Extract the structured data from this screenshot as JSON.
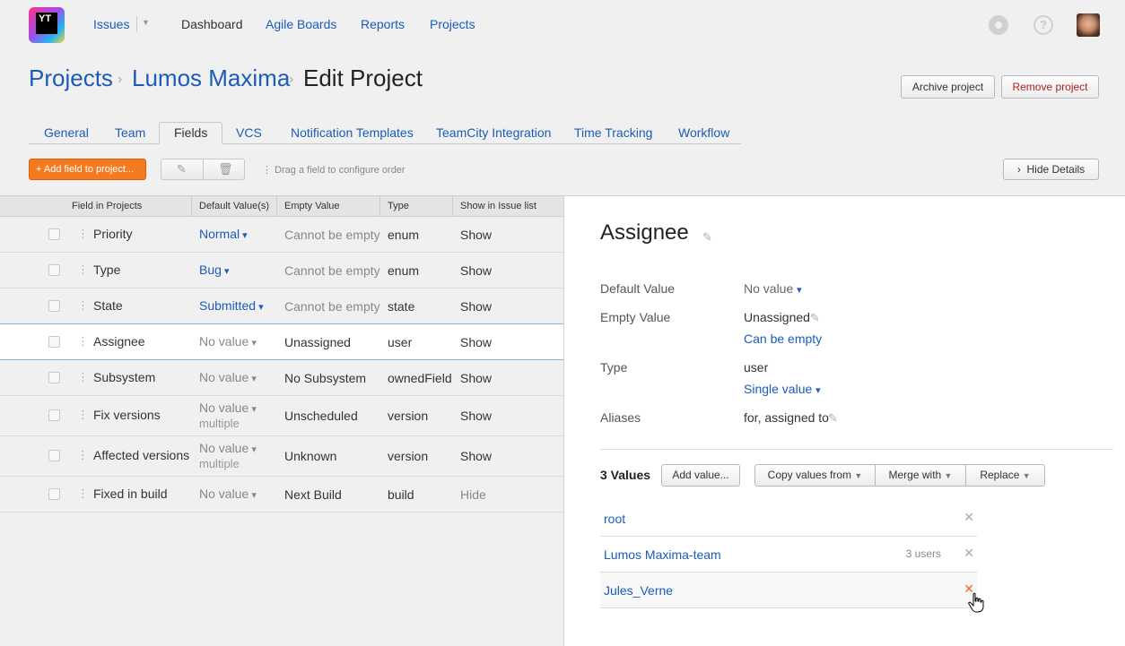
{
  "nav": {
    "logo": "YT",
    "issues": "Issues",
    "dashboard": "Dashboard",
    "agile_boards": "Agile Boards",
    "reports": "Reports",
    "projects": "Projects",
    "help": "?"
  },
  "breadcrumb": {
    "projects": "Projects",
    "project": "Lumos Maxima",
    "current": "Edit Project",
    "separator": "›"
  },
  "header_buttons": {
    "archive": "Archive project",
    "remove": "Remove project"
  },
  "tabs": [
    "General",
    "Team",
    "Fields",
    "VCS",
    "Notification Templates",
    "TeamCity Integration",
    "Time Tracking",
    "Workflow"
  ],
  "toolbar": {
    "add_field": "+ Add field to project...",
    "drag_hint": "Drag a field to configure order",
    "hide_details": "Hide Details"
  },
  "table": {
    "headers": [
      "Field in Projects",
      "Default Value(s)",
      "Empty Value",
      "Type",
      "Show in Issue list"
    ],
    "rows": [
      {
        "name": "Priority",
        "default": "Normal",
        "default_sub": "",
        "empty": "Cannot be empty",
        "type": "enum",
        "show": "Show"
      },
      {
        "name": "Type",
        "default": "Bug",
        "default_sub": "",
        "empty": "Cannot be empty",
        "type": "enum",
        "show": "Show"
      },
      {
        "name": "State",
        "default": "Submitted",
        "default_sub": "",
        "empty": "Cannot be empty",
        "type": "state",
        "show": "Show"
      },
      {
        "name": "Assignee",
        "default": "No value",
        "default_sub": "",
        "empty": "Unassigned",
        "type": "user",
        "show": "Show"
      },
      {
        "name": "Subsystem",
        "default": "No value",
        "default_sub": "",
        "empty": "No Subsystem",
        "type": "ownedField",
        "show": "Show"
      },
      {
        "name": "Fix versions",
        "default": "No value",
        "default_sub": "multiple",
        "empty": "Unscheduled",
        "type": "version",
        "show": "Show"
      },
      {
        "name": "Affected versions",
        "default": "No value",
        "default_sub": "multiple",
        "empty": "Unknown",
        "type": "version",
        "show": "Show"
      },
      {
        "name": "Fixed in build",
        "default": "No value",
        "default_sub": "",
        "empty": "Next Build",
        "type": "build",
        "show": "Hide"
      }
    ]
  },
  "details": {
    "title": "Assignee",
    "default_label": "Default Value",
    "default_value": "No value",
    "empty_label": "Empty Value",
    "empty_value": "Unassigned",
    "empty_link": "Can be empty",
    "type_label": "Type",
    "type_value": "user",
    "type_mode": "Single value",
    "aliases_label": "Aliases",
    "aliases_value": "for, assigned to",
    "values_count": "3 Values",
    "add_value": "Add value...",
    "copy_values": "Copy values from",
    "merge_with": "Merge with",
    "replace": "Replace",
    "values": [
      {
        "name": "root",
        "users": ""
      },
      {
        "name": "Lumos Maxima-team",
        "users": "3 users"
      },
      {
        "name": "Jules_Verne",
        "users": ""
      }
    ]
  },
  "colors": {
    "link": "#1a5cb8",
    "accent_orange": "#f47a20",
    "remove_red": "#b02020"
  }
}
